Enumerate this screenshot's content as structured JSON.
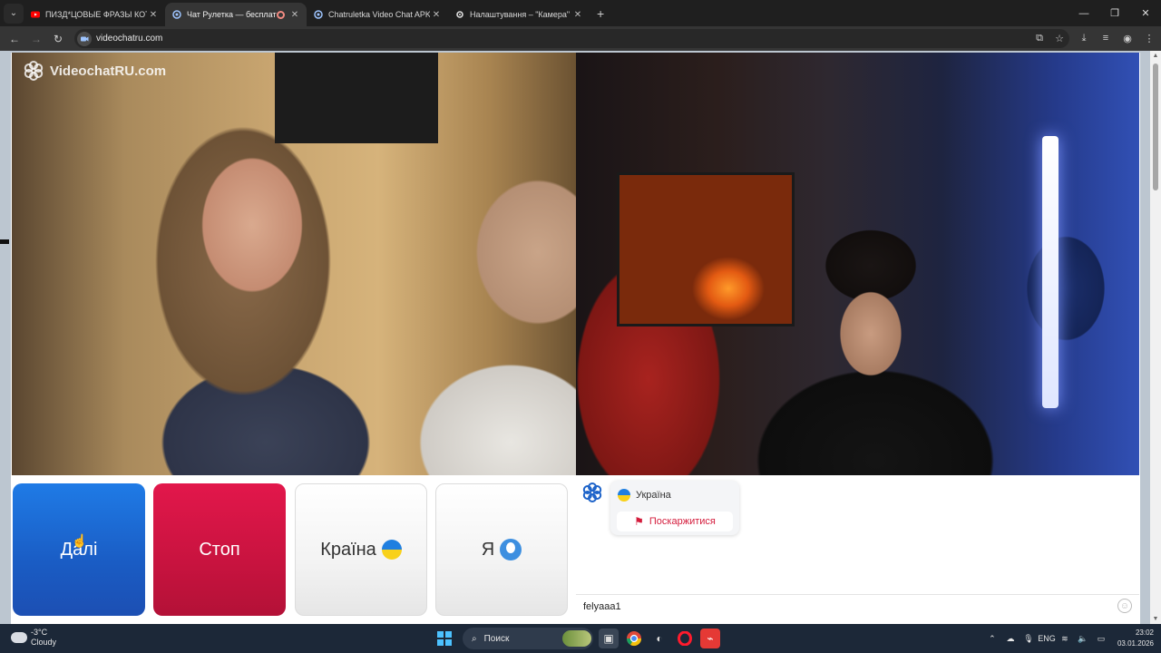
{
  "browser": {
    "tabs": [
      {
        "title": "ПИЗД*ЦОВЫЕ ФРАЗЫ КОТОР...",
        "icon": "youtube-icon",
        "active": false
      },
      {
        "title": "Чат Рулетка — бесплатный",
        "icon": "chat-roulette-icon",
        "active": true
      },
      {
        "title": "Chatruletka Video Chat APK для...",
        "icon": "chat-roulette-icon",
        "active": false
      },
      {
        "title": "Налаштування – \"Камера\"",
        "icon": "gear-icon",
        "active": false
      }
    ],
    "url": "videochatru.com"
  },
  "site": {
    "logo_text": "VideochatRU.com"
  },
  "controls": {
    "next_label": "Далі",
    "stop_label": "Стоп",
    "country_label": "Країна",
    "me_label": "Я"
  },
  "chat": {
    "partner_country": "Україна",
    "report_label": "Поскаржитися",
    "input_value": "felyaaa1"
  },
  "taskbar": {
    "temperature": "-3°C",
    "weather": "Cloudy",
    "search_label": "Поиск",
    "language": "ENG",
    "time": "23:02",
    "date": "03.01.2026"
  },
  "colors": {
    "next": "#1a5cc4",
    "stop": "#c8133f",
    "report": "#d41c3c"
  }
}
